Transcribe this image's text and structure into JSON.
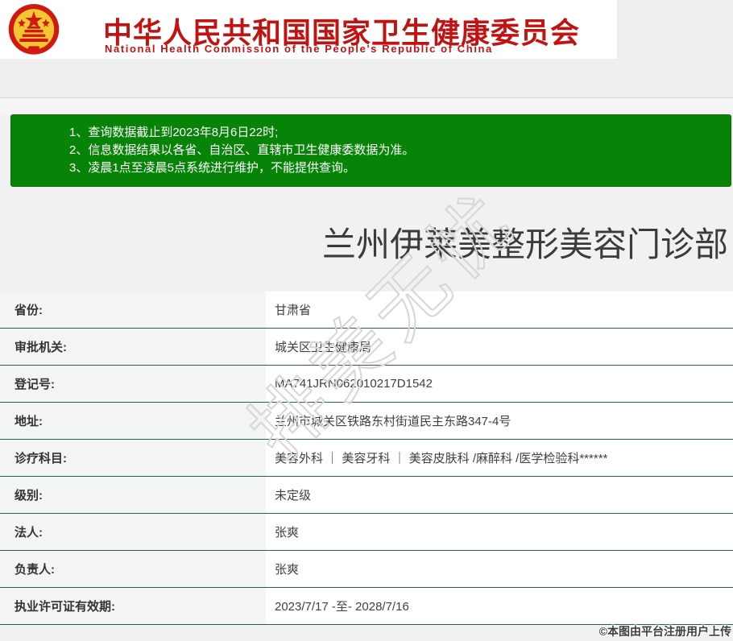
{
  "header": {
    "emblem_icon": "china-national-emblem",
    "title_cn": "中华人民共和国国家卫生健康委员会",
    "title_en": "National Health Commission of the People's Republic of China",
    "brand_red": "#c01312"
  },
  "notice": {
    "bg": "#078407",
    "items": [
      "1、查询数据截止到2023年8月6日22时;",
      "2、信息数据结果以各省、自治区、直辖市卫生健康委数据为准。",
      "3、凌晨1点至凌晨5点系统进行维护，不能提供查询。"
    ]
  },
  "result": {
    "institution_name": "兰州伊莱美整形美容门诊部",
    "rows": [
      {
        "label": "省份:",
        "value": "甘肃省"
      },
      {
        "label": "审批机关:",
        "value": "城关区卫生健康局"
      },
      {
        "label": "登记号:",
        "value": "MA741JRN062010217D1542"
      },
      {
        "label": "地址:",
        "value": "兰州市城关区铁路东村街道民主东路347-4号"
      },
      {
        "label": "诊疗科目:",
        "value": "美容外科 ｜ 美容牙科 ｜ 美容皮肤科 /麻醉科 /医学检验科******"
      },
      {
        "label": "级别:",
        "value": "未定级"
      },
      {
        "label": "法人:",
        "value": "张爽"
      },
      {
        "label": "负责人:",
        "value": "张爽"
      },
      {
        "label": "执业许可证有效期:",
        "value": "2023/7/17 -至- 2028/7/16"
      }
    ]
  },
  "watermarks": {
    "diagonal_text": "排美无忧",
    "copyright_text": "©本图由平台注册用户上传"
  },
  "colors": {
    "notice_green": "#078407",
    "table_border_green": "#2b5f4c",
    "label_cell_bg": "#f2f5f2"
  }
}
